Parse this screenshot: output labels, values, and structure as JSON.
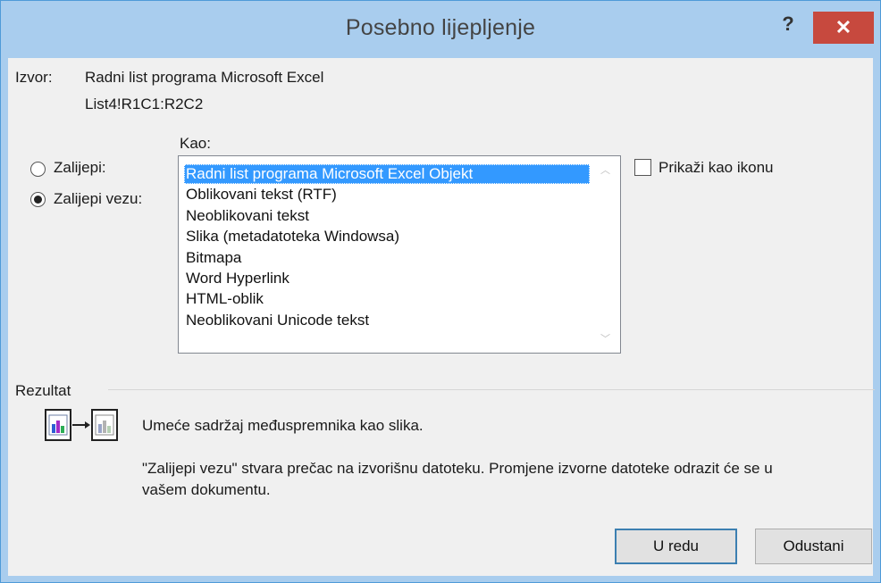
{
  "dialog": {
    "title": "Posebno lijepljenje",
    "help_label": "?",
    "close_label": "✕"
  },
  "source": {
    "label": "Izvor:",
    "value": "Radni list programa Microsoft Excel",
    "range": "List4!R1C1:R2C2"
  },
  "as_label": "Kao:",
  "paste_options": [
    {
      "label": "Zalijepi:",
      "checked": false
    },
    {
      "label": "Zalijepi vezu:",
      "checked": true
    }
  ],
  "formats": [
    "Radni list programa Microsoft Excel Objekt",
    "Oblikovani tekst (RTF)",
    "Neoblikovani tekst",
    "Slika (metadatoteka Windowsa)",
    "Bitmapa",
    "Word Hyperlink",
    "HTML-oblik",
    "Neoblikovani Unicode tekst"
  ],
  "selected_format_index": 0,
  "display_as_icon": {
    "label": "Prikaži kao ikonu",
    "checked": false
  },
  "result": {
    "label": "Rezultat",
    "line1": "Umeće sadržaj međuspremnika kao slika.",
    "line2": "\"Zalijepi vezu\" stvara prečac na izvorišnu datoteku. Promjene izvorne datoteke odrazit će se u",
    "line3": "vašem dokumentu."
  },
  "buttons": {
    "ok": "U redu",
    "cancel": "Odustani"
  },
  "icons": {
    "scroll_up": "scroll-up-arrow-icon",
    "scroll_down": "scroll-down-arrow-icon",
    "result_illustration": "paste-link-chart-icon"
  }
}
